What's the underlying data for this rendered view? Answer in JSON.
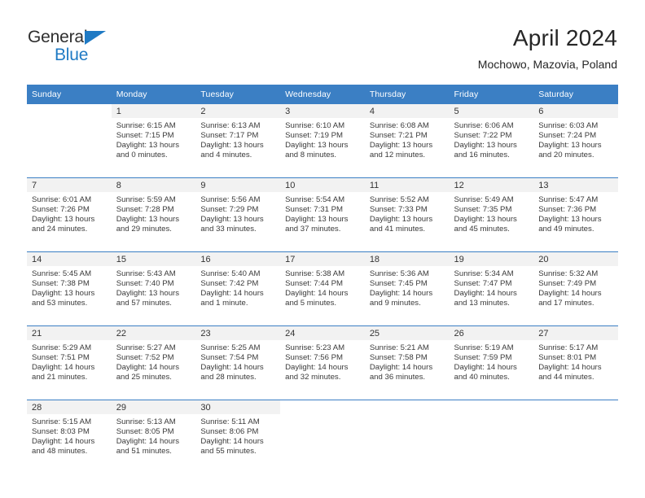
{
  "brand": {
    "name_top": "General",
    "name_bottom": "Blue",
    "triangle_color": "#1f7ac4"
  },
  "header": {
    "title": "April 2024",
    "subtitle": "Mochowo, Mazovia, Poland"
  },
  "theme": {
    "header_blue": "#3b7fc4",
    "daynum_band": "#f2f2f2",
    "text": "#3a3a3a"
  },
  "weekdays": [
    "Sunday",
    "Monday",
    "Tuesday",
    "Wednesday",
    "Thursday",
    "Friday",
    "Saturday"
  ],
  "labels": {
    "sunrise": "Sunrise:",
    "sunset": "Sunset:",
    "daylight": "Daylight:"
  },
  "weeks": [
    [
      {
        "day": "",
        "sunrise": "",
        "sunset": "",
        "daylight1": "",
        "daylight2": "",
        "blank": true
      },
      {
        "day": "1",
        "sunrise": "Sunrise: 6:15 AM",
        "sunset": "Sunset: 7:15 PM",
        "daylight1": "Daylight: 13 hours",
        "daylight2": "and 0 minutes."
      },
      {
        "day": "2",
        "sunrise": "Sunrise: 6:13 AM",
        "sunset": "Sunset: 7:17 PM",
        "daylight1": "Daylight: 13 hours",
        "daylight2": "and 4 minutes."
      },
      {
        "day": "3",
        "sunrise": "Sunrise: 6:10 AM",
        "sunset": "Sunset: 7:19 PM",
        "daylight1": "Daylight: 13 hours",
        "daylight2": "and 8 minutes."
      },
      {
        "day": "4",
        "sunrise": "Sunrise: 6:08 AM",
        "sunset": "Sunset: 7:21 PM",
        "daylight1": "Daylight: 13 hours",
        "daylight2": "and 12 minutes."
      },
      {
        "day": "5",
        "sunrise": "Sunrise: 6:06 AM",
        "sunset": "Sunset: 7:22 PM",
        "daylight1": "Daylight: 13 hours",
        "daylight2": "and 16 minutes."
      },
      {
        "day": "6",
        "sunrise": "Sunrise: 6:03 AM",
        "sunset": "Sunset: 7:24 PM",
        "daylight1": "Daylight: 13 hours",
        "daylight2": "and 20 minutes."
      }
    ],
    [
      {
        "day": "7",
        "sunrise": "Sunrise: 6:01 AM",
        "sunset": "Sunset: 7:26 PM",
        "daylight1": "Daylight: 13 hours",
        "daylight2": "and 24 minutes."
      },
      {
        "day": "8",
        "sunrise": "Sunrise: 5:59 AM",
        "sunset": "Sunset: 7:28 PM",
        "daylight1": "Daylight: 13 hours",
        "daylight2": "and 29 minutes."
      },
      {
        "day": "9",
        "sunrise": "Sunrise: 5:56 AM",
        "sunset": "Sunset: 7:29 PM",
        "daylight1": "Daylight: 13 hours",
        "daylight2": "and 33 minutes."
      },
      {
        "day": "10",
        "sunrise": "Sunrise: 5:54 AM",
        "sunset": "Sunset: 7:31 PM",
        "daylight1": "Daylight: 13 hours",
        "daylight2": "and 37 minutes."
      },
      {
        "day": "11",
        "sunrise": "Sunrise: 5:52 AM",
        "sunset": "Sunset: 7:33 PM",
        "daylight1": "Daylight: 13 hours",
        "daylight2": "and 41 minutes."
      },
      {
        "day": "12",
        "sunrise": "Sunrise: 5:49 AM",
        "sunset": "Sunset: 7:35 PM",
        "daylight1": "Daylight: 13 hours",
        "daylight2": "and 45 minutes."
      },
      {
        "day": "13",
        "sunrise": "Sunrise: 5:47 AM",
        "sunset": "Sunset: 7:36 PM",
        "daylight1": "Daylight: 13 hours",
        "daylight2": "and 49 minutes."
      }
    ],
    [
      {
        "day": "14",
        "sunrise": "Sunrise: 5:45 AM",
        "sunset": "Sunset: 7:38 PM",
        "daylight1": "Daylight: 13 hours",
        "daylight2": "and 53 minutes."
      },
      {
        "day": "15",
        "sunrise": "Sunrise: 5:43 AM",
        "sunset": "Sunset: 7:40 PM",
        "daylight1": "Daylight: 13 hours",
        "daylight2": "and 57 minutes."
      },
      {
        "day": "16",
        "sunrise": "Sunrise: 5:40 AM",
        "sunset": "Sunset: 7:42 PM",
        "daylight1": "Daylight: 14 hours",
        "daylight2": "and 1 minute."
      },
      {
        "day": "17",
        "sunrise": "Sunrise: 5:38 AM",
        "sunset": "Sunset: 7:44 PM",
        "daylight1": "Daylight: 14 hours",
        "daylight2": "and 5 minutes."
      },
      {
        "day": "18",
        "sunrise": "Sunrise: 5:36 AM",
        "sunset": "Sunset: 7:45 PM",
        "daylight1": "Daylight: 14 hours",
        "daylight2": "and 9 minutes."
      },
      {
        "day": "19",
        "sunrise": "Sunrise: 5:34 AM",
        "sunset": "Sunset: 7:47 PM",
        "daylight1": "Daylight: 14 hours",
        "daylight2": "and 13 minutes."
      },
      {
        "day": "20",
        "sunrise": "Sunrise: 5:32 AM",
        "sunset": "Sunset: 7:49 PM",
        "daylight1": "Daylight: 14 hours",
        "daylight2": "and 17 minutes."
      }
    ],
    [
      {
        "day": "21",
        "sunrise": "Sunrise: 5:29 AM",
        "sunset": "Sunset: 7:51 PM",
        "daylight1": "Daylight: 14 hours",
        "daylight2": "and 21 minutes."
      },
      {
        "day": "22",
        "sunrise": "Sunrise: 5:27 AM",
        "sunset": "Sunset: 7:52 PM",
        "daylight1": "Daylight: 14 hours",
        "daylight2": "and 25 minutes."
      },
      {
        "day": "23",
        "sunrise": "Sunrise: 5:25 AM",
        "sunset": "Sunset: 7:54 PM",
        "daylight1": "Daylight: 14 hours",
        "daylight2": "and 28 minutes."
      },
      {
        "day": "24",
        "sunrise": "Sunrise: 5:23 AM",
        "sunset": "Sunset: 7:56 PM",
        "daylight1": "Daylight: 14 hours",
        "daylight2": "and 32 minutes."
      },
      {
        "day": "25",
        "sunrise": "Sunrise: 5:21 AM",
        "sunset": "Sunset: 7:58 PM",
        "daylight1": "Daylight: 14 hours",
        "daylight2": "and 36 minutes."
      },
      {
        "day": "26",
        "sunrise": "Sunrise: 5:19 AM",
        "sunset": "Sunset: 7:59 PM",
        "daylight1": "Daylight: 14 hours",
        "daylight2": "and 40 minutes."
      },
      {
        "day": "27",
        "sunrise": "Sunrise: 5:17 AM",
        "sunset": "Sunset: 8:01 PM",
        "daylight1": "Daylight: 14 hours",
        "daylight2": "and 44 minutes."
      }
    ],
    [
      {
        "day": "28",
        "sunrise": "Sunrise: 5:15 AM",
        "sunset": "Sunset: 8:03 PM",
        "daylight1": "Daylight: 14 hours",
        "daylight2": "and 48 minutes."
      },
      {
        "day": "29",
        "sunrise": "Sunrise: 5:13 AM",
        "sunset": "Sunset: 8:05 PM",
        "daylight1": "Daylight: 14 hours",
        "daylight2": "and 51 minutes."
      },
      {
        "day": "30",
        "sunrise": "Sunrise: 5:11 AM",
        "sunset": "Sunset: 8:06 PM",
        "daylight1": "Daylight: 14 hours",
        "daylight2": "and 55 minutes."
      },
      {
        "day": "",
        "sunrise": "",
        "sunset": "",
        "daylight1": "",
        "daylight2": "",
        "blank": true
      },
      {
        "day": "",
        "sunrise": "",
        "sunset": "",
        "daylight1": "",
        "daylight2": "",
        "blank": true
      },
      {
        "day": "",
        "sunrise": "",
        "sunset": "",
        "daylight1": "",
        "daylight2": "",
        "blank": true
      },
      {
        "day": "",
        "sunrise": "",
        "sunset": "",
        "daylight1": "",
        "daylight2": "",
        "blank": true
      }
    ]
  ]
}
